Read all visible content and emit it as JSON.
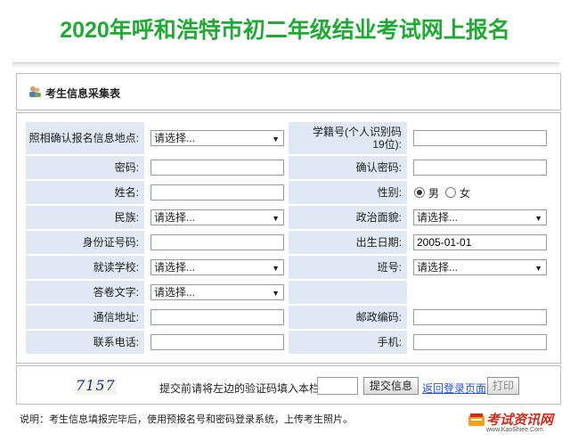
{
  "page_title": "2020年呼和浩特市初二年级结业考试网上报名",
  "panel_title": "考生信息采集表",
  "colors": {
    "title_green": "#1faa34",
    "label_bg": "#dfe8f3",
    "link_blue": "#2a55c8",
    "brand_red": "#d42a1a"
  },
  "form": {
    "photo_site_label": "照相确认报名信息地点:",
    "photo_site_value": "请选择...",
    "student_id_label": "学籍号(个人识别码19位):",
    "password_label": "密码:",
    "confirm_password_label": "确认密码:",
    "name_label": "姓名:",
    "gender_label": "性别:",
    "gender_male": "男",
    "gender_female": "女",
    "ethnicity_label": "民族:",
    "ethnicity_value": "请选择...",
    "political_label": "政治面貌:",
    "political_value": "请选择...",
    "id_card_label": "身份证号码:",
    "birthdate_label": "出生日期:",
    "birthdate_value": "2005-01-01",
    "school_label": "就读学校:",
    "school_value": "请选择...",
    "class_label": "班号:",
    "class_value": "请选择...",
    "answer_lang_label": "答卷文字:",
    "answer_lang_value": "请选择...",
    "address_label": "通信地址:",
    "postcode_label": "邮政编码:",
    "phone_label": "联系电话:",
    "mobile_label": "手机:"
  },
  "bottom": {
    "captcha": "7157",
    "prompt": "提交前请将左边的验证码填入本栏:",
    "submit_label": "提交信息",
    "back_link": "返回登录页面",
    "print_label": "打印"
  },
  "note": "说明：考生信息填报完毕后，使用预报名号和密码登录系统，上传考生照片。",
  "logo": {
    "brand": "考试资讯网",
    "url": "www.KaoShiee.Com"
  }
}
